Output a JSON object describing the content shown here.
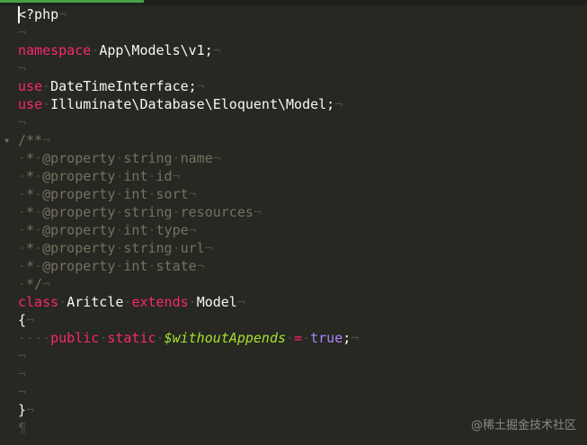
{
  "editor": {
    "lines": [
      [
        {
          "t": "<?php",
          "c": "p"
        }
      ],
      [],
      [
        {
          "t": "namespace",
          "c": "k"
        },
        {
          "t": " App\\Models\\v1;",
          "c": "p"
        }
      ],
      [],
      [
        {
          "t": "use",
          "c": "k"
        },
        {
          "t": " DateTimeInterface;",
          "c": "p"
        }
      ],
      [
        {
          "t": "use",
          "c": "k"
        },
        {
          "t": " Illuminate\\Database\\Eloquent\\Model;",
          "c": "p"
        }
      ],
      [],
      [
        {
          "t": "/**",
          "c": "c"
        }
      ],
      [
        {
          "t": " * @property string name",
          "c": "c"
        }
      ],
      [
        {
          "t": " * @property int id",
          "c": "c"
        }
      ],
      [
        {
          "t": " * @property int sort",
          "c": "c"
        }
      ],
      [
        {
          "t": " * @property string resources",
          "c": "c"
        }
      ],
      [
        {
          "t": " * @property int type",
          "c": "c"
        }
      ],
      [
        {
          "t": " * @property string url",
          "c": "c"
        }
      ],
      [
        {
          "t": " * @property int state",
          "c": "c"
        }
      ],
      [
        {
          "t": " */",
          "c": "c"
        }
      ],
      [
        {
          "t": "class",
          "c": "k"
        },
        {
          "t": " Aritcle ",
          "c": "p"
        },
        {
          "t": "extends",
          "c": "k"
        },
        {
          "t": " Model",
          "c": "p"
        }
      ],
      [
        {
          "t": "{",
          "c": "p"
        }
      ],
      [
        {
          "t": "    ",
          "c": "p"
        },
        {
          "t": "public",
          "c": "k"
        },
        {
          "t": " ",
          "c": "p"
        },
        {
          "t": "static",
          "c": "k"
        },
        {
          "t": " ",
          "c": "p"
        },
        {
          "t": "$withoutAppends",
          "c": "v"
        },
        {
          "t": " ",
          "c": "p"
        },
        {
          "t": "=",
          "c": "o"
        },
        {
          "t": " ",
          "c": "p"
        },
        {
          "t": "true",
          "c": "b"
        },
        {
          "t": ";",
          "c": "p"
        }
      ],
      [],
      [],
      [],
      [
        {
          "t": "}",
          "c": "p"
        }
      ],
      []
    ],
    "eol_marker": "¬",
    "space_marker": "·",
    "eof_marker": "¶",
    "fold_marker": "▼",
    "fold_lines": [
      7
    ],
    "colors": {
      "background": "#272822",
      "keyword": "#f92672",
      "plain": "#f8f8f2",
      "comment": "#75715e",
      "variable": "#a6e22e",
      "boolean": "#ae81ff",
      "invisible": "#4a4b44"
    }
  },
  "watermark": {
    "text": "@稀土掘金技术社区"
  }
}
